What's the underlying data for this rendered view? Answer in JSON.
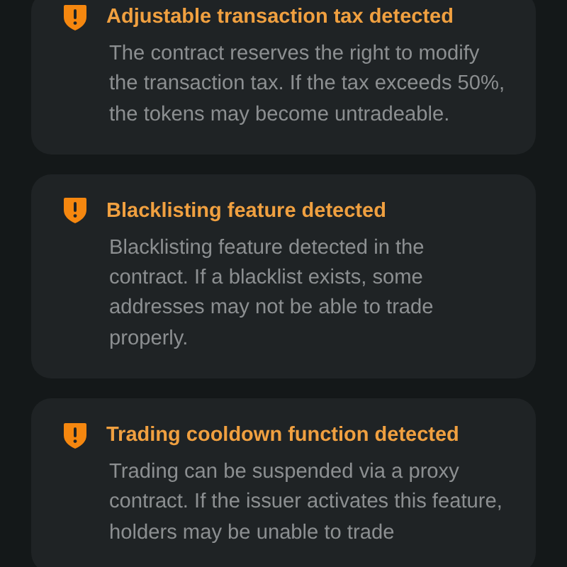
{
  "alerts": [
    {
      "kind": "warning",
      "title": "Adjustable transaction tax detected",
      "description": "The contract reserves the right to modify the transaction tax. If the tax exceeds 50%, the tokens may become untradeable."
    },
    {
      "kind": "warning",
      "title": "Blacklisting feature detected",
      "description": "Blacklisting feature detected in the contract. If a blacklist exists, some addresses may not be able to trade properly."
    },
    {
      "kind": "warning",
      "title": "Trading cooldown function detected",
      "description": "Trading can be suspended via a proxy contract. If the issuer activates this feature, holders may be unable to trade"
    }
  ]
}
